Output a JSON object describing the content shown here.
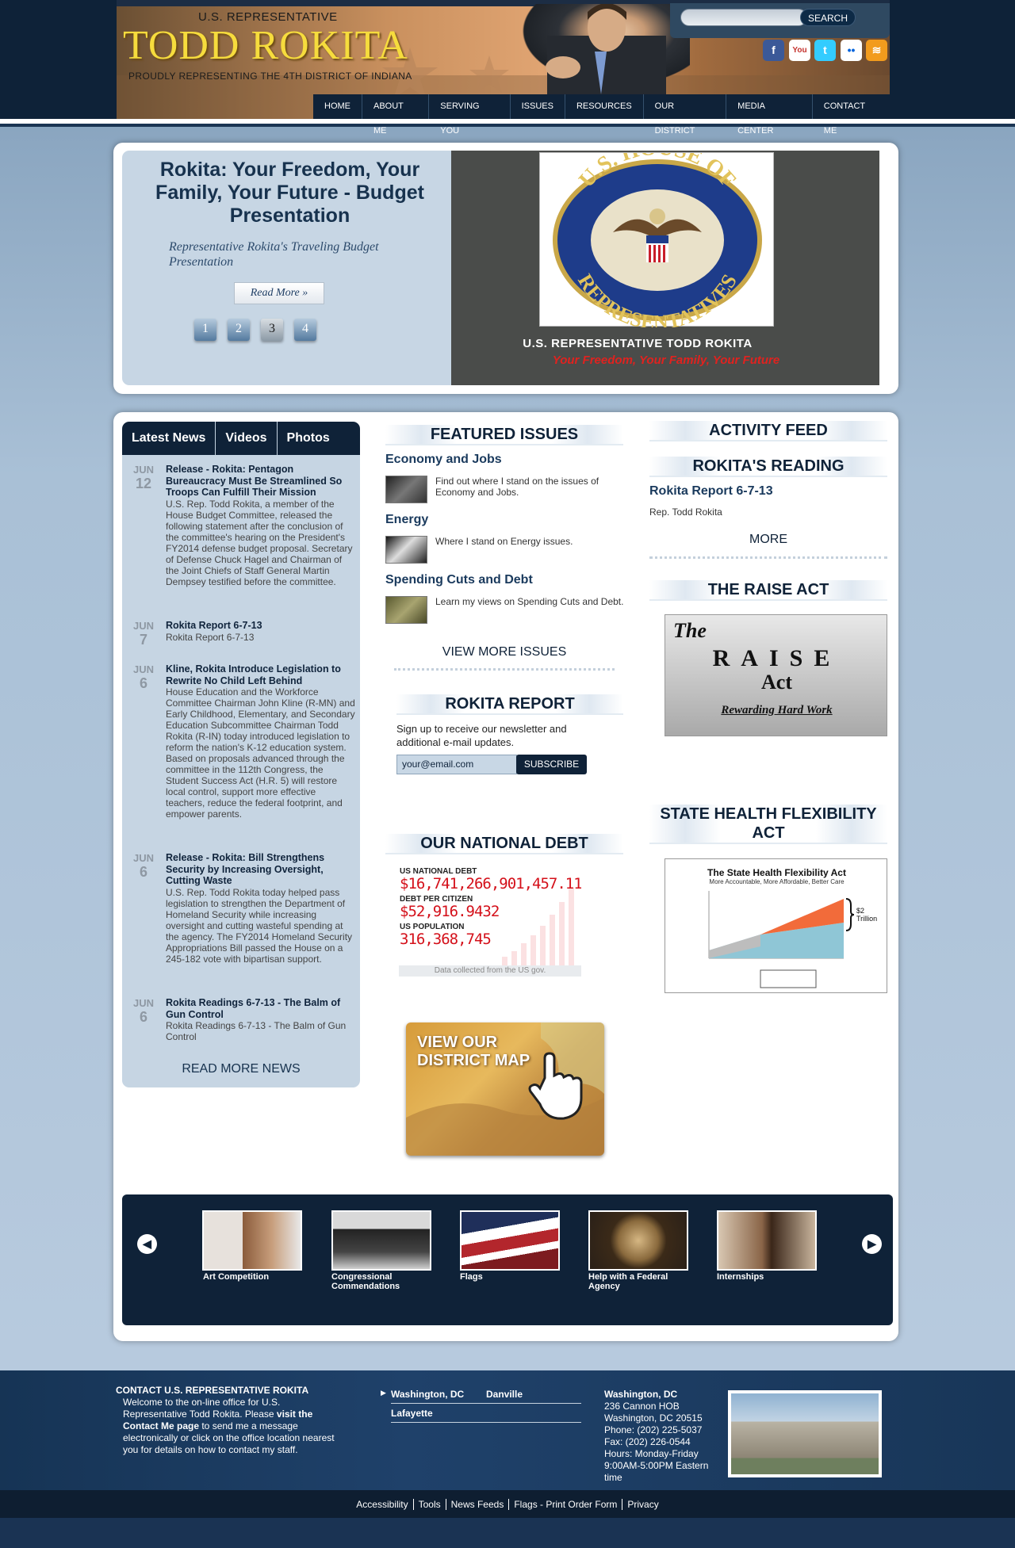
{
  "header": {
    "pre_title": "U.S. REPRESENTATIVE",
    "title": "TODD ROKITA",
    "tagline": "PROUDLY REPRESENTING THE 4TH DISTRICT OF INDIANA",
    "search_button": "SEARCH",
    "social": [
      "f",
      "You",
      "t",
      "••",
      "≋"
    ]
  },
  "nav": [
    "HOME",
    "ABOUT ME",
    "SERVING YOU",
    "ISSUES",
    "RESOURCES",
    "OUR DISTRICT",
    "MEDIA CENTER",
    "CONTACT ME"
  ],
  "slider": {
    "title": "Rokita: Your Freedom, Your Family, Your Future - Budget Presentation",
    "subtitle": "Representative Rokita's Traveling Budget Presentation",
    "read_more": "Read More »",
    "pages": [
      "1",
      "2",
      "3",
      "4"
    ],
    "active_page": 3,
    "seal_lines": [
      "U.S. HOUSE OF",
      "REPRESENTATIVES"
    ],
    "caption": "U.S. Representative Todd Rokita",
    "tagline": "Your Freedom, Your Family, Your Future"
  },
  "news": {
    "tabs": [
      "Latest News",
      "Videos",
      "Photos"
    ],
    "items": [
      {
        "month": "JUN",
        "day": "12",
        "title": "Release - Rokita: Pentagon Bureaucracy Must Be Streamlined So Troops Can Fulfill Their Mission",
        "body": "U.S. Rep. Todd Rokita, a member of the House Budget Committee, released the following statement after the conclusion of the committee's hearing on the President's FY2014 defense budget proposal. Secretary of Defense Chuck Hagel and Chairman of the Joint Chiefs of Staff General Martin Dempsey testified before the committee."
      },
      {
        "month": "JUN",
        "day": "7",
        "title": "Rokita Report 6-7-13",
        "body": "Rokita Report 6-7-13"
      },
      {
        "month": "JUN",
        "day": "6",
        "title": "Kline, Rokita Introduce Legislation to Rewrite No Child Left Behind",
        "body": "House Education and the Workforce Committee Chairman John Kline (R-MN) and Early Childhood, Elementary, and Secondary Education Subcommittee Chairman Todd Rokita (R-IN) today introduced legislation to reform the nation's K-12 education system. Based on proposals advanced through the committee in the 112th Congress, the Student Success Act (H.R. 5) will restore local control, support more effective teachers, reduce the federal footprint, and empower parents."
      },
      {
        "month": "JUN",
        "day": "6",
        "title": "Release - Rokita: Bill Strengthens Security by Increasing Oversight, Cutting Waste",
        "body": "U.S. Rep. Todd Rokita today helped pass legislation to strengthen the Department of Homeland Security while increasing oversight and cutting wasteful spending at the agency. The FY2014 Homeland Security Appropriations Bill passed the House on a 245-182 vote with bipartisan support."
      },
      {
        "month": "JUN",
        "day": "6",
        "title": "Rokita Readings 6-7-13 - The Balm of Gun Control",
        "body": "Rokita Readings 6-7-13 - The Balm of Gun Control"
      }
    ],
    "read_more": "READ MORE NEWS"
  },
  "featured": {
    "heading": "FEATURED ISSUES",
    "issues": [
      {
        "title": "Economy and Jobs",
        "text": "Find out where I stand on the issues of Economy and Jobs."
      },
      {
        "title": "Energy",
        "text": "Where I stand on Energy issues."
      },
      {
        "title": "Spending Cuts and Debt",
        "text": "Learn my views on Spending Cuts and Debt."
      }
    ],
    "view_more": "VIEW MORE ISSUES"
  },
  "report": {
    "heading": "ROKITA REPORT",
    "text": "Sign up to receive our newsletter and additional e-mail updates.",
    "email_value": "your@email.com",
    "subscribe": "SUBSCRIBE"
  },
  "debt": {
    "heading": "OUR NATIONAL DEBT",
    "label1": "US NATIONAL DEBT",
    "value1": "$16,741,266,901,457.11",
    "label2": "DEBT PER CITIZEN",
    "value2": "$52,916.9432",
    "label3": "US POPULATION",
    "value3": "316,368,745",
    "note": "Data collected from the US gov."
  },
  "district_map": "VIEW OUR DISTRICT MAP",
  "right": {
    "activity_heading": "ACTIVITY FEED",
    "reading_heading": "ROKITA'S READING",
    "reading_title": "Rokita Report 6-7-13",
    "reading_author": "Rep. Todd Rokita",
    "more": "MORE",
    "raise_heading": "THE RAISE ACT",
    "raise_the": "The",
    "raise_word": "RAISE",
    "raise_act": "Act",
    "raise_sub": "Rewarding Hard Work",
    "health_heading": "STATE HEALTH FLEXIBILITY ACT",
    "health_img_title": "The State Health Flexibility Act",
    "health_img_sub": "More Accountable, More Affordable, Better Care",
    "health_img_note": "$2 Trillion"
  },
  "carousel": [
    {
      "label": "Art Competition",
      "color": "#d8cfc7"
    },
    {
      "label": "Congressional Commendations",
      "color": "#6d6f70"
    },
    {
      "label": "Flags",
      "color": "#9b2a2e"
    },
    {
      "label": "Help with a Federal Agency",
      "color": "#6b5a3c"
    },
    {
      "label": "Internships",
      "color": "#c6b49c"
    }
  ],
  "footer": {
    "contact_heading": "CONTACT U.S. REPRESENTATIVE ROKITA",
    "contact_text_1": "Welcome to the on-line office for U.S. Representative Todd Rokita. Please ",
    "contact_link_1": "visit the Contact Me page",
    "contact_text_2": " to send me a message electronically or click on the office location nearest you for details on how to contact my staff.",
    "offices": [
      "Washington, DC",
      "Danville",
      "Lafayette"
    ],
    "office_name": "Washington, DC",
    "office_lines": [
      "236 Cannon HOB",
      "Washington, DC 20515",
      "Phone: (202) 225-5037",
      "Fax: (202) 226-0544",
      "Hours: Monday-Friday",
      "9:00AM-5:00PM Eastern time"
    ],
    "links": [
      "Accessibility",
      "Tools",
      "News Feeds",
      "Flags - Print Order Form",
      "Privacy"
    ]
  }
}
